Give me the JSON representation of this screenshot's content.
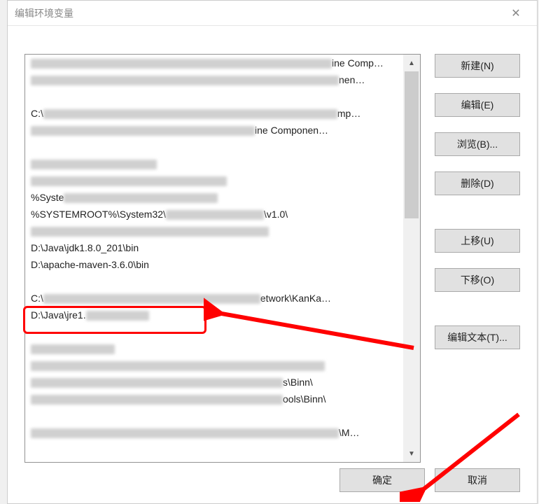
{
  "window": {
    "title": "编辑环境变量",
    "close": "✕"
  },
  "list": {
    "items": [
      {
        "text": "",
        "blur_width": 430,
        "suffix": "ine Comp…"
      },
      {
        "text": "",
        "blur_width": 440,
        "suffix": "nen…"
      },
      {
        "text": "",
        "blur_width": 0,
        "suffix": ""
      },
      {
        "text": "C:\\",
        "blur_width": 420,
        "suffix": "mp…"
      },
      {
        "text": "",
        "blur_width": 320,
        "suffix": "ine Componen…"
      },
      {
        "text": "",
        "blur_width": 0,
        "suffix": ""
      },
      {
        "text": "",
        "blur_width": 180,
        "suffix": ""
      },
      {
        "text": "",
        "blur_width": 280,
        "suffix": ""
      },
      {
        "text": "%Syste",
        "blur_width": 220,
        "suffix": ""
      },
      {
        "text": "%SYSTEMROOT%\\System32\\",
        "blur_width": 140,
        "suffix": "\\v1.0\\"
      },
      {
        "text": "",
        "blur_width": 340,
        "suffix": ""
      },
      {
        "text": "D:\\Java\\jdk1.8.0_201\\bin",
        "blur_width": 0,
        "suffix": ""
      },
      {
        "text": "D:\\apache-maven-3.6.0\\bin",
        "blur_width": 0,
        "suffix": ""
      },
      {
        "text": "",
        "blur_width": 0,
        "suffix": ""
      },
      {
        "text": "C:\\",
        "blur_width": 310,
        "suffix": "etwork\\KanKa…"
      },
      {
        "text": "D:\\Java\\jre1.",
        "blur_width": 90,
        "suffix": ""
      },
      {
        "text": "",
        "blur_width": 0,
        "suffix": ""
      },
      {
        "text": "",
        "blur_width": 120,
        "prefix_blur": 50,
        "suffix": ""
      },
      {
        "text": "",
        "blur_width": 420,
        "suffix": ""
      },
      {
        "text": "",
        "blur_width": 360,
        "suffix": "s\\Binn\\"
      },
      {
        "text": "",
        "blur_width": 360,
        "suffix": "ools\\Binn\\"
      },
      {
        "text": "",
        "blur_width": 0,
        "suffix": ""
      },
      {
        "text": "",
        "blur_width": 440,
        "suffix": "\\M…"
      }
    ]
  },
  "buttons": {
    "new": "新建(N)",
    "edit": "编辑(E)",
    "browse": "浏览(B)...",
    "delete": "删除(D)",
    "moveup": "上移(U)",
    "movedown": "下移(O)",
    "edittext": "编辑文本(T)...",
    "ok": "确定",
    "cancel": "取消"
  }
}
